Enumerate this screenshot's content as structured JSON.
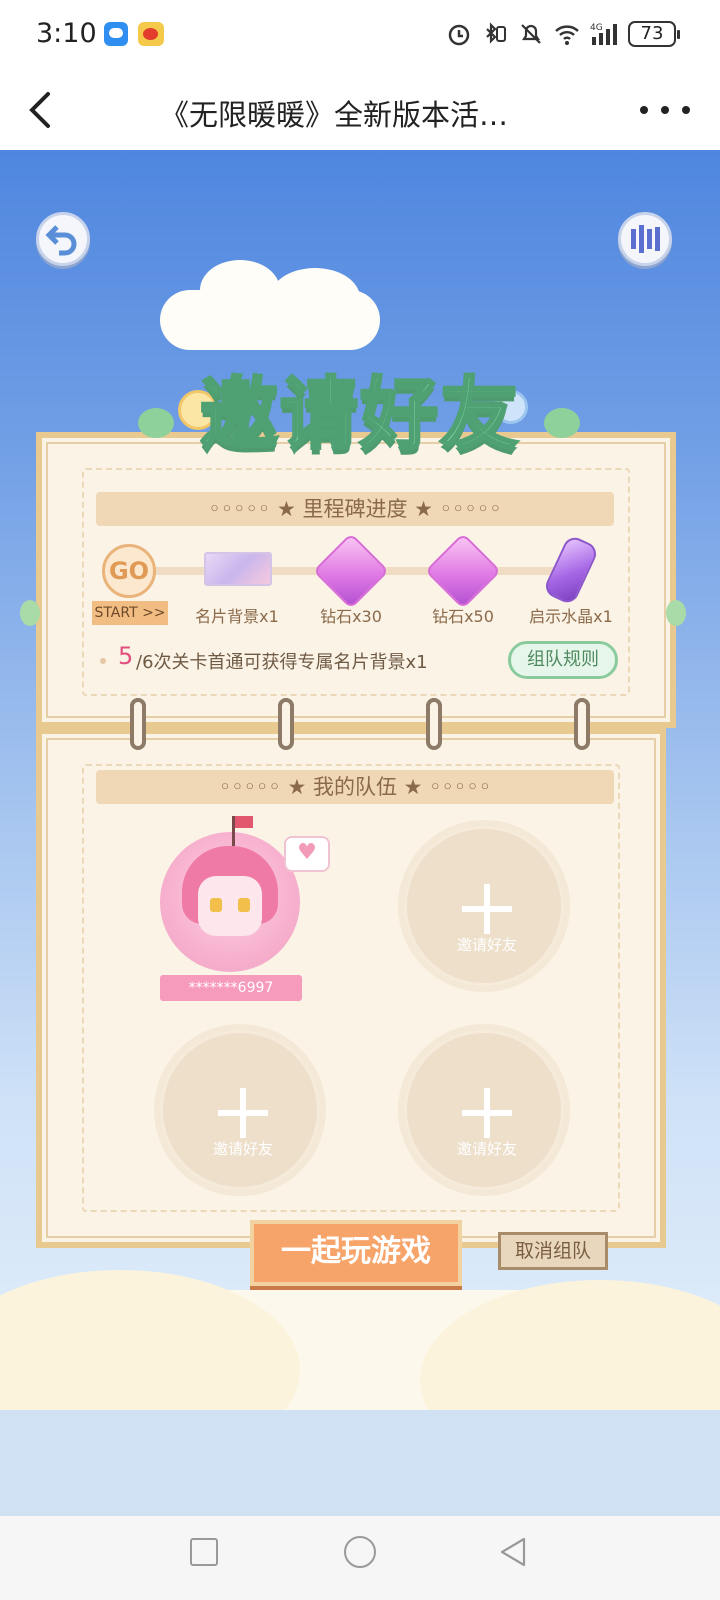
{
  "status_bar": {
    "time": "3:10",
    "battery": "73",
    "network": "4G"
  },
  "title_bar": {
    "title": "《无限暖暖》全新版本活…"
  },
  "game": {
    "heading": "邀请好友",
    "milestone": {
      "banner": "◦◦◦◦◦ ★ 里程碑进度 ★ ◦◦◦◦◦",
      "start_badge": "GO",
      "start_label": "START >>",
      "items": [
        {
          "label": "名片背景x1",
          "icon": "card-background"
        },
        {
          "label": "钻石x30",
          "icon": "diamond"
        },
        {
          "label": "钻石x50",
          "icon": "diamond"
        },
        {
          "label": "启示水晶x1",
          "icon": "crystal"
        }
      ],
      "progress_current": "5",
      "progress_text": "/6次关卡首通可获得专属名片背景x1",
      "rules_button": "组队规则"
    },
    "team": {
      "banner": "◦◦◦◦◦ ★ 我的队伍 ★ ◦◦◦◦◦",
      "member_name": "*******6997",
      "invite_label": "邀请好友",
      "play_button": "一起玩游戏",
      "cancel_button": "取消组队"
    }
  },
  "colors": {
    "sky_top": "#4f86df",
    "panel_bg": "#fbf3e6",
    "title_green": "#7dcf9c",
    "play_orange": "#f7a46a",
    "progress_pink": "#e0507f"
  }
}
